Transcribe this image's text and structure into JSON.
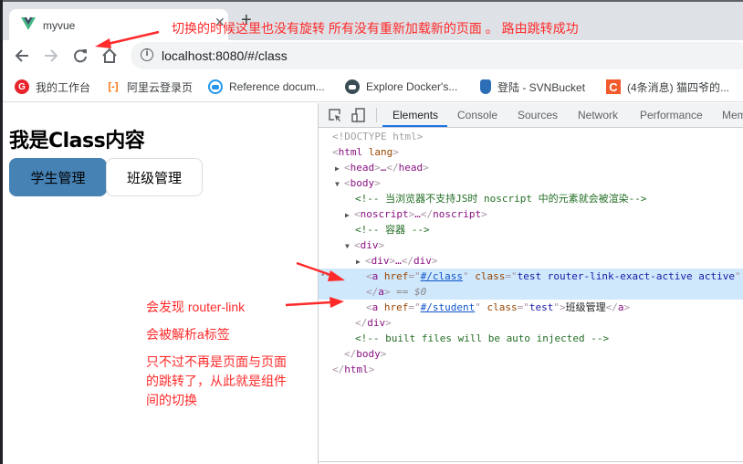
{
  "browser": {
    "tab": {
      "title": "myvue",
      "favicon": "vue-logo-icon",
      "close_icon": "close-icon"
    },
    "new_tab_icon": "plus-icon",
    "nav": {
      "back_icon": "arrow-left-icon",
      "forward_icon": "arrow-right-icon",
      "reload_icon": "reload-icon",
      "home_icon": "home-icon"
    },
    "address": {
      "info_icon": "info-icon",
      "url": "localhost:8080/#/class"
    },
    "bookmarks": [
      {
        "label": "我的工作台",
        "icon": "G",
        "color": "#e8232b"
      },
      {
        "label": "阿里云登录页",
        "icon": "[-]",
        "color": "#ff6a00"
      },
      {
        "label": "Reference docum...",
        "icon": "docker-icon",
        "color": "#2496ed"
      },
      {
        "label": "Explore Docker's...",
        "icon": "docker-dark-icon",
        "color": "#394d54"
      },
      {
        "label": "登陆 - SVNBucket",
        "icon": "bucket-icon",
        "color": "#2d6fb7"
      },
      {
        "label": "(4条消息) 猫四爷的...",
        "icon": "C",
        "color": "#f15a2b"
      }
    ]
  },
  "page": {
    "title": "我是Class内容",
    "links": [
      {
        "label": "学生管理",
        "active": true
      },
      {
        "label": "班级管理",
        "active": false
      }
    ],
    "active_color": "#4682b4"
  },
  "devtools": {
    "tabs": [
      "Elements",
      "Console",
      "Sources",
      "Network",
      "Performance",
      "Mem"
    ],
    "active_tab": "Elements",
    "tree": {
      "doctype": "<!DOCTYPE html>",
      "html_open": "html",
      "html_attr": "lang",
      "head": "head",
      "body": "body",
      "comment1": "<!-- 当浏览器不支持JS时 noscript 中的元素就会被渲染-->",
      "noscript": "noscript",
      "comment2": "<!-- 容器 -->",
      "div": "div",
      "a1_href": "#/class",
      "a1_class": "test router-link-exact-active active",
      "a1_eq": "== $0",
      "a2_href": "#/student",
      "a2_class": "test",
      "a2_text": "班级管理",
      "comment3": "<!-- built files will be auto injected -->",
      "ellipsis": "…"
    }
  },
  "annotations": {
    "top": "切换的时候这里也没有旋转  所有没有重新加载新的页面 。 路由跳转成功",
    "line1": "会发现 router-link",
    "line2": "会被解析a标签",
    "line3": "只不过不再是页面与页面",
    "line4": "的跳转了，从此就是组件",
    "line5": "间的切换",
    "color": "#ff2a2a"
  }
}
